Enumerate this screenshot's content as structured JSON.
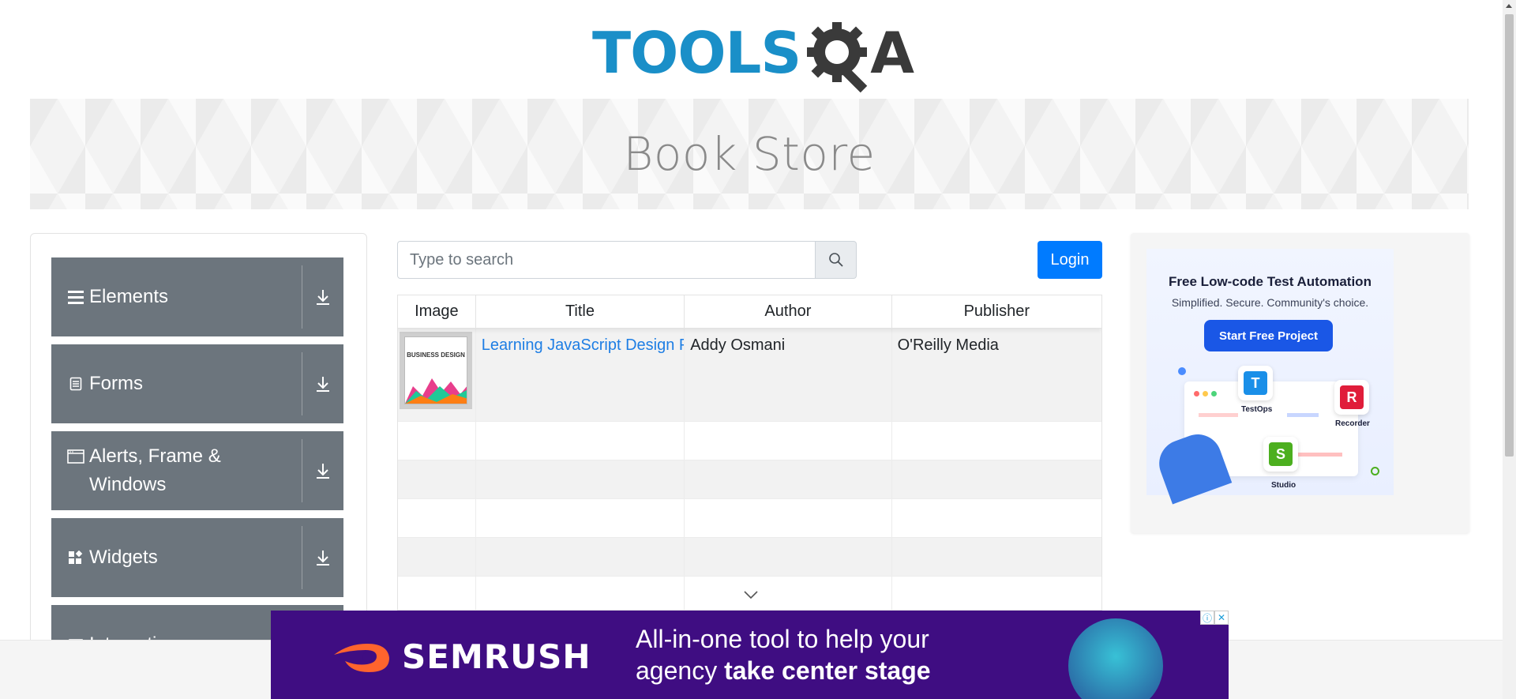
{
  "header": {
    "logo_text": "TOOLS",
    "logo_suffix": "A",
    "logo_colors": {
      "primary": "#1a8fc8",
      "secondary": "#3a3a3a"
    }
  },
  "banner": {
    "title": "Book Store"
  },
  "sidebar": {
    "items": [
      {
        "label": "Elements",
        "icon": "hamburger-icon"
      },
      {
        "label": "Forms",
        "icon": "document-icon"
      },
      {
        "label": "Alerts, Frame & Windows",
        "icon": "window-icon"
      },
      {
        "label": "Widgets",
        "icon": "widgets-icon"
      },
      {
        "label": "Interactions",
        "icon": "interactions-icon"
      }
    ],
    "item_color": "#6c757d"
  },
  "search": {
    "placeholder": "Type to search",
    "value": ""
  },
  "login": {
    "label": "Login",
    "color": "#007bff"
  },
  "table": {
    "headers": [
      "Image",
      "Title",
      "Author",
      "Publisher"
    ],
    "rows": [
      {
        "image_alt": "BUSINESS DESIGN",
        "title": "Learning JavaScript Design Patterns",
        "author": "Addy Osmani",
        "publisher": "O'Reilly Media"
      }
    ],
    "empty_rows": 4
  },
  "side_ad": {
    "title": "Free Low-code Test Automation",
    "subtitle": "Simplified. Secure. Community's choice.",
    "button": "Start Free Project",
    "tiles": [
      {
        "letter": "T",
        "label": "TestOps",
        "color": "#1a8fe8"
      },
      {
        "letter": "R",
        "label": "Recorder",
        "color": "#e01d3a"
      },
      {
        "letter": "S",
        "label": "Studio",
        "color": "#4caf1f"
      }
    ]
  },
  "bottom_ad": {
    "brand": "SEMRUSH",
    "line1": "All-in-one tool to help your",
    "line2_plain": "agency ",
    "line2_bold": "take center stage",
    "brand_color": "#ff642d",
    "background": "#3f0d82"
  }
}
